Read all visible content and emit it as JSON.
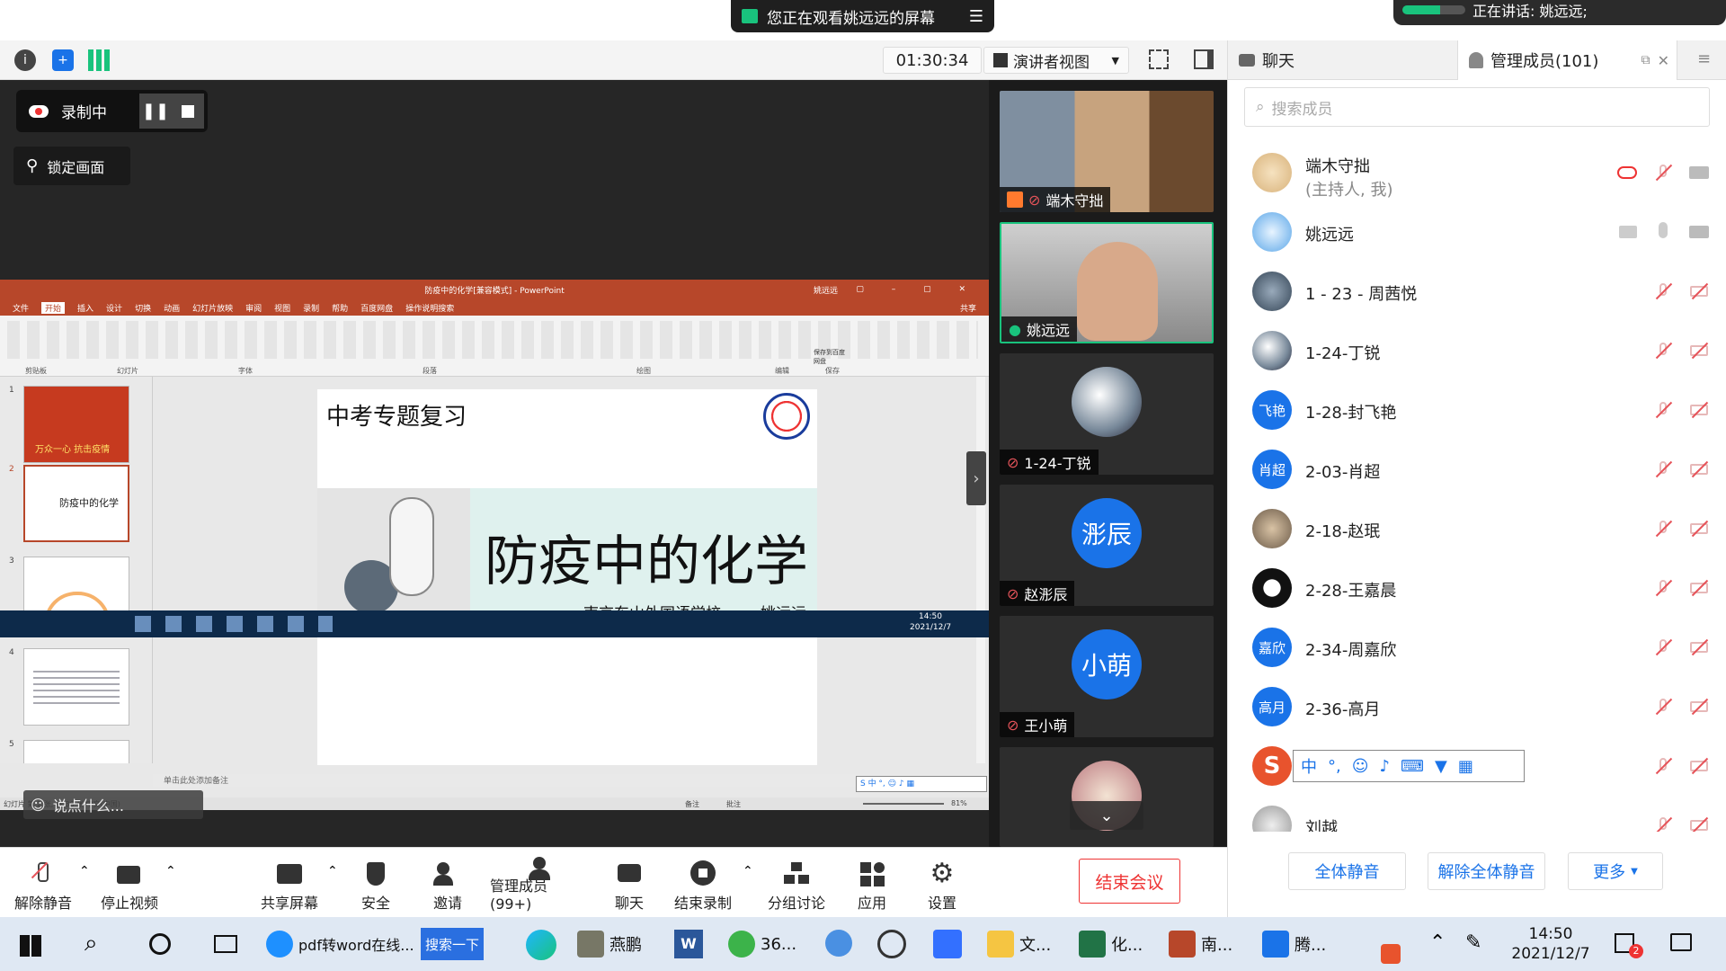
{
  "banner": {
    "viewing_text": "您正在观看姚远远的屏幕",
    "speaking_text": "正在讲话: 姚远远;"
  },
  "toolbar": {
    "timer": "01:30:34",
    "view_mode": "演讲者视图"
  },
  "recording": {
    "status": "录制中",
    "lock_screen": "锁定画面"
  },
  "ppt": {
    "window_title": "防疫中的化学[兼容模式] - PowerPoint",
    "menu": [
      "文件",
      "开始",
      "插入",
      "设计",
      "切换",
      "动画",
      "幻灯片放映",
      "审阅",
      "视图",
      "录制",
      "帮助",
      "百度网盘",
      "操作说明搜索"
    ],
    "user": "姚远远",
    "share": "共享",
    "ribbon_groups": [
      "剪贴板",
      "幻灯片",
      "字体",
      "段落",
      "绘图",
      "编辑",
      "保存"
    ],
    "ribbon_save_label": "保存到百度网盘",
    "thumb_numbers": [
      "1",
      "2",
      "3",
      "4",
      "5"
    ],
    "thumb1_caption": "万众一心 抗击疫情",
    "thumb2_caption": "防疫中的化学",
    "notes_placeholder": "单击此处添加备注",
    "status_left": "幻灯片 第 2 张, 共 36 张  中文(中国)",
    "zoom": "81%",
    "status_notes": "备注",
    "status_comments": "批注",
    "slide": {
      "header": "中考专题复习",
      "title": "防疫中的化学",
      "school": "南京东山外国语学校",
      "author": "姚远远"
    },
    "inner_clock_time": "14:50",
    "inner_clock_date": "2021/12/7",
    "chat_placeholder": "说点什么..."
  },
  "videos": [
    {
      "name": "端木守拙"
    },
    {
      "name": "姚远远"
    },
    {
      "name": "1-24-丁锐"
    },
    {
      "name": "赵浵辰",
      "avatar_text": "浵辰"
    },
    {
      "name": "王小萌",
      "avatar_text": "小萌"
    }
  ],
  "right_panel": {
    "tab_chat": "聊天",
    "tab_members": "管理成员(101)",
    "search_placeholder": "搜索成员",
    "members": [
      {
        "name": "端木守拙",
        "sub": "(主持人, 我)",
        "avatar": ""
      },
      {
        "name": "姚远远",
        "avatar": ""
      },
      {
        "name": "1 - 23 - 周茜悦",
        "avatar": ""
      },
      {
        "name": "1-24-丁锐",
        "avatar": ""
      },
      {
        "name": "1-28-封飞艳",
        "avatar": "飞艳"
      },
      {
        "name": "2-03-肖超",
        "avatar": "肖超"
      },
      {
        "name": "2-18-赵珉",
        "avatar": ""
      },
      {
        "name": "2-28-王嘉晨",
        "avatar": ""
      },
      {
        "name": "2-34-周嘉欣",
        "avatar": "嘉欣"
      },
      {
        "name": "2-36-高月",
        "avatar": "高月"
      },
      {
        "name": "",
        "avatar": ""
      },
      {
        "name": "刘越",
        "avatar": ""
      }
    ],
    "ime_text": "中",
    "btn_mute_all": "全体静音",
    "btn_unmute_all": "解除全体静音",
    "btn_more": "更多"
  },
  "meeting_bar": {
    "items": [
      "解除静音",
      "停止视频",
      "共享屏幕",
      "安全",
      "邀请",
      "管理成员(99+)",
      "聊天",
      "结束录制",
      "分组讨论",
      "应用",
      "设置"
    ],
    "end_meeting": "结束会议"
  },
  "taskbar": {
    "browser_task": "pdf转word在线...",
    "search_button": "搜索一下",
    "app_yanpeng": "燕鹏",
    "app_360": "36...",
    "app_folder": "文...",
    "app_excel": "化...",
    "app_ppt": "南...",
    "app_tencent": "腾...",
    "time": "14:50",
    "date": "2021/12/7",
    "notify_count": "2"
  },
  "colors": {
    "ppt_accent": "#b7472a",
    "zoom_blue": "#1a73e8",
    "end_red": "#e33333",
    "mute_red": "#e6545a"
  }
}
